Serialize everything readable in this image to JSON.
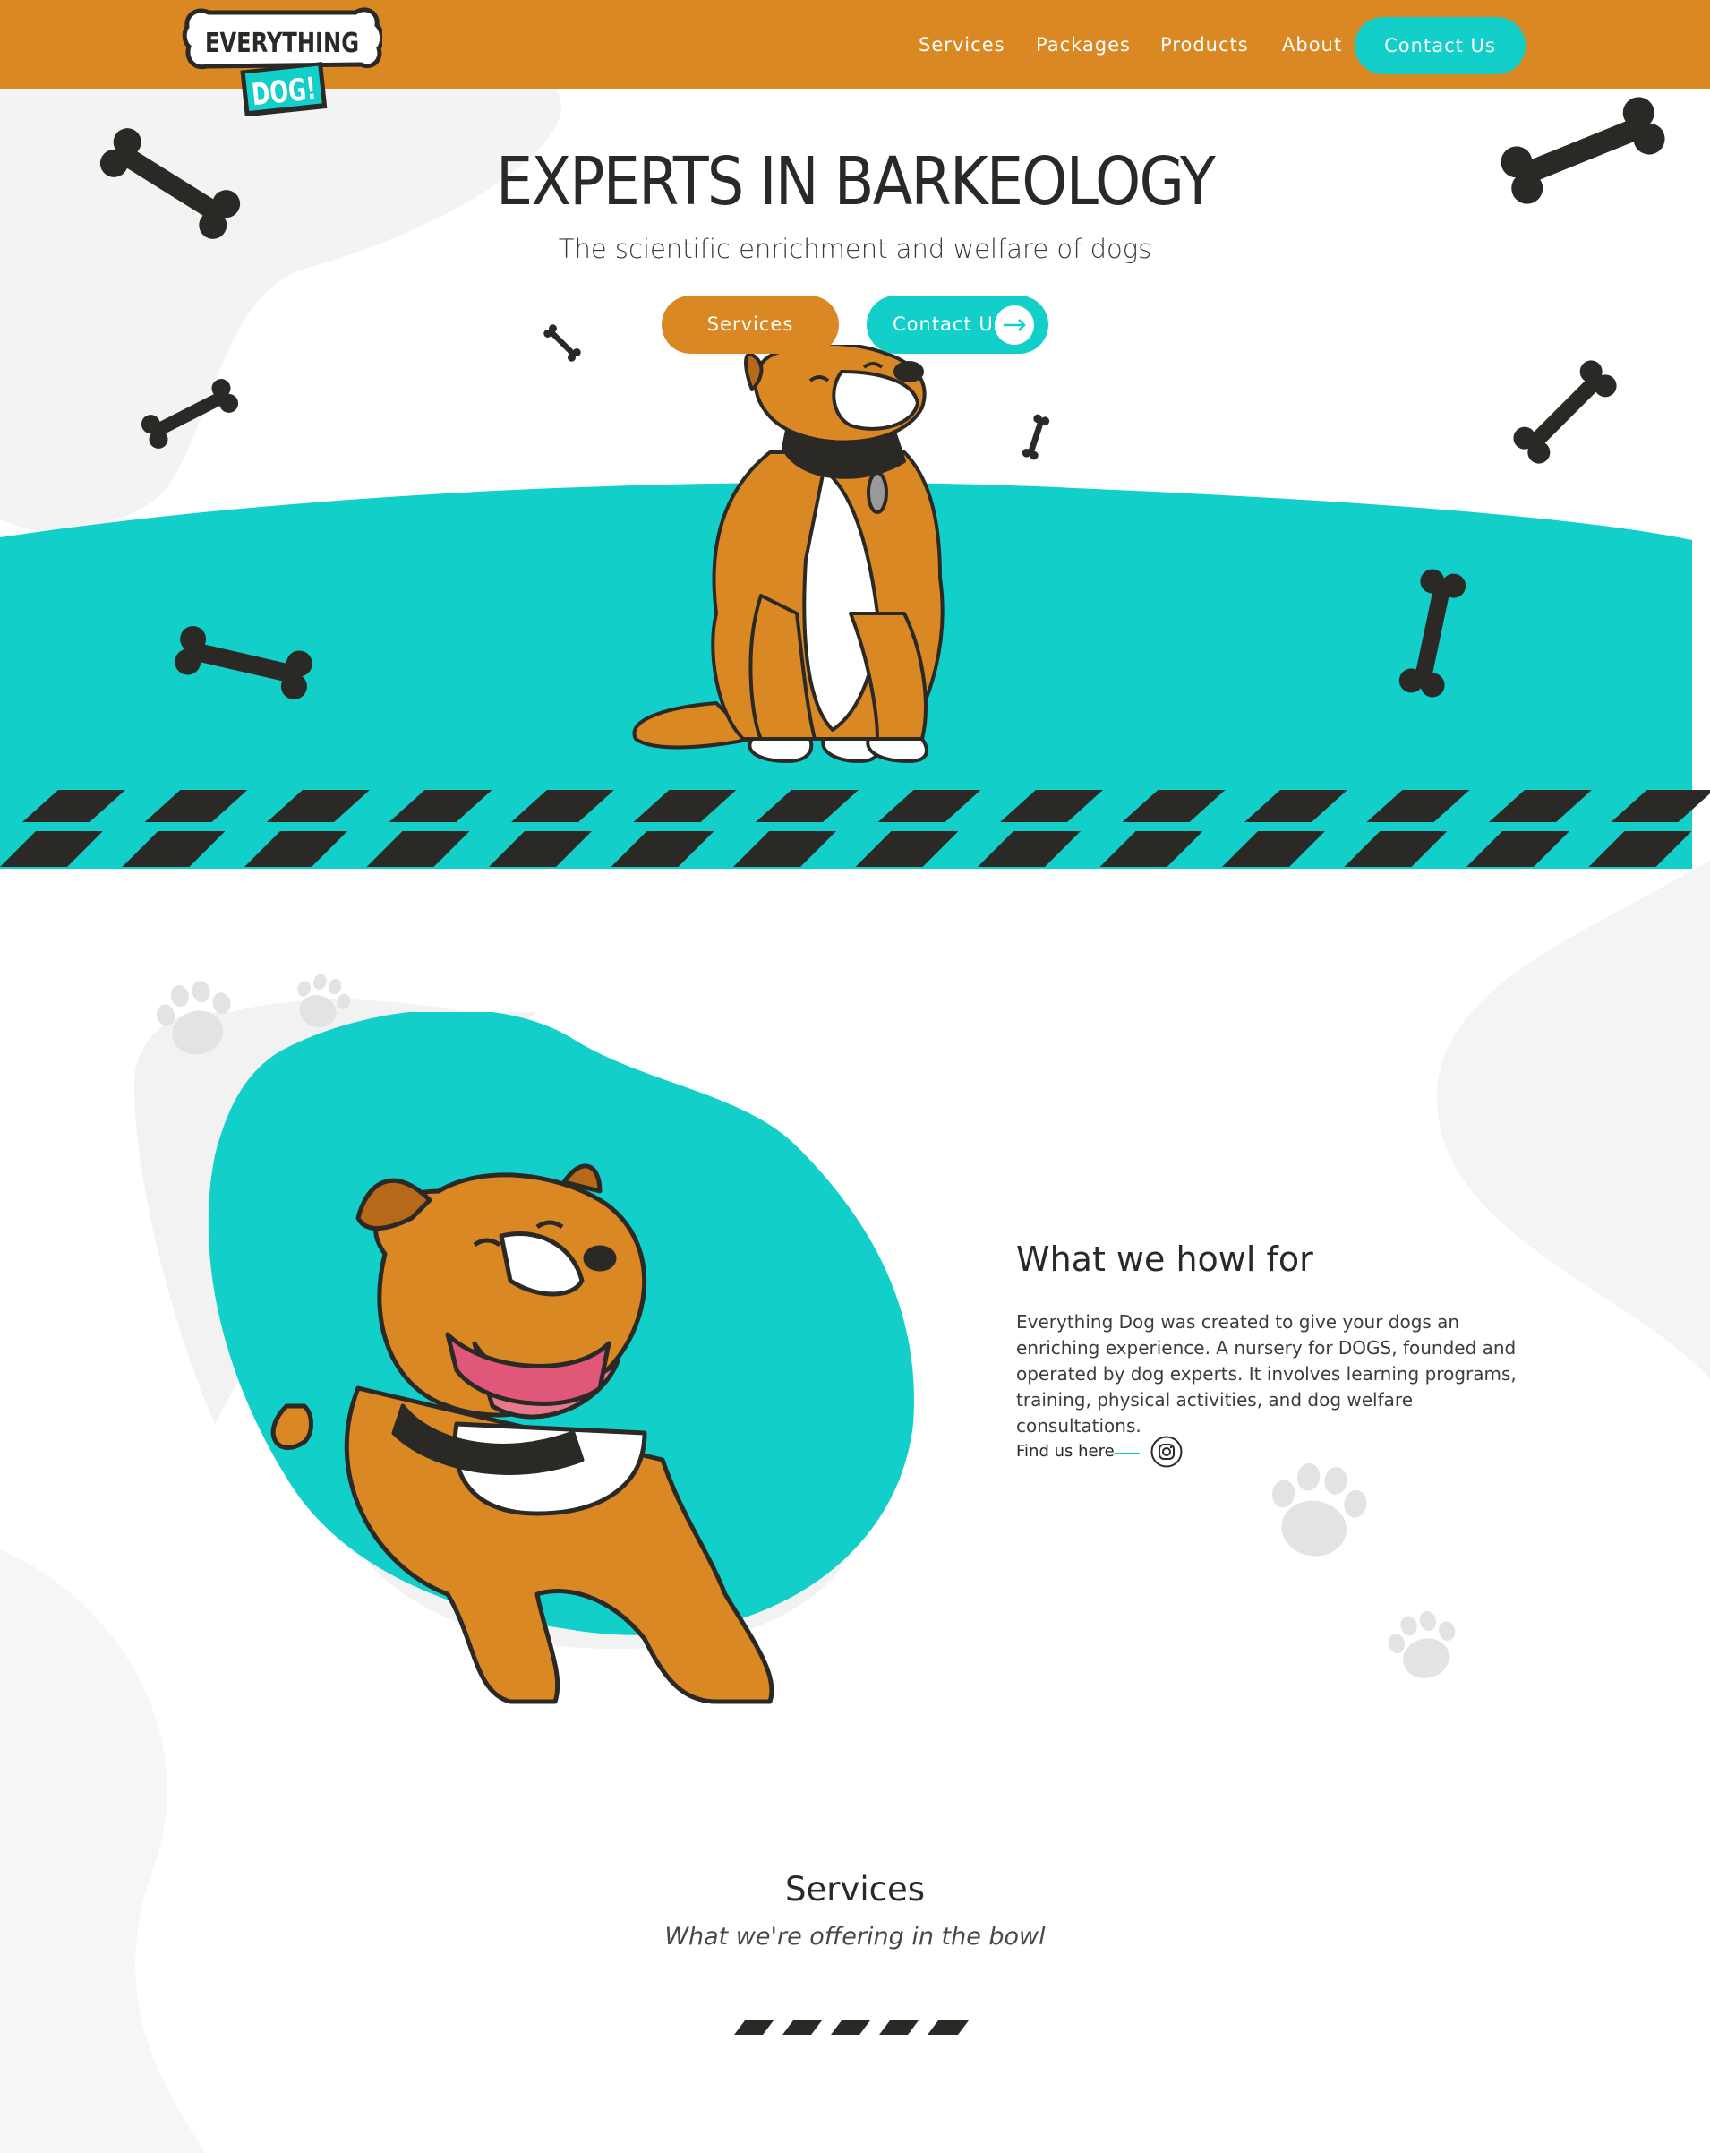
{
  "brand": {
    "logo_top": "EVERYTHING",
    "logo_bottom": "DOG!",
    "colors": {
      "orange": "#da8823",
      "teal": "#12cfca",
      "dark": "#2b2926",
      "grey_shape": "#f2f2f2"
    }
  },
  "nav": {
    "items": [
      {
        "label": "Services"
      },
      {
        "label": "Packages"
      },
      {
        "label": "Products"
      },
      {
        "label": "About"
      }
    ],
    "cta_label": "Contact Us"
  },
  "hero": {
    "title": "EXPERTS IN BARKEOLOGY",
    "subtitle": "The scientific enrichment and welfare of dogs",
    "primary_button": "Services",
    "secondary_button": "Contact Us",
    "arrow_icon": "arrow-right-icon"
  },
  "about": {
    "title": "What we howl for",
    "text": "Everything Dog was created to give your dogs an enriching experience. A nursery for DOGS, founded and operated by dog experts. It involves learning programs, training, physical activities, and dog welfare consultations.",
    "find_us_label": "Find us here",
    "social_icon": "instagram-icon"
  },
  "services": {
    "title": "Services",
    "subtitle": "What we're offering in the bowl"
  }
}
